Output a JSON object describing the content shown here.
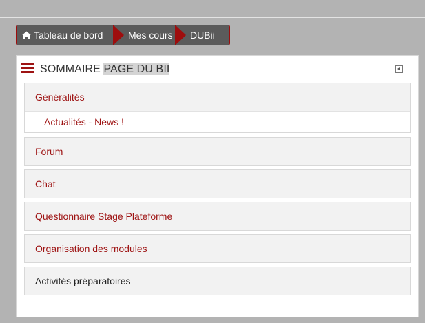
{
  "breadcrumb": {
    "items": [
      {
        "label": "Tableau de bord",
        "icon": "home-icon"
      },
      {
        "label": "Mes cours"
      },
      {
        "label": "DUBii"
      }
    ],
    "background": "#5b5b5b",
    "accent": "#9e0d0d"
  },
  "block": {
    "title_plain": "SOMMAIRE ",
    "title_highlight": "PAGE DU BII",
    "menu_icon": "hamburger-menu-icon",
    "dock_icon": "dock-block-icon"
  },
  "sections": [
    {
      "label": "Généralités",
      "items": [
        "Actualités - News !"
      ]
    },
    {
      "label": "Forum"
    },
    {
      "label": "Chat"
    },
    {
      "label": "Questionnaire Stage Plateforme"
    },
    {
      "label": "Organisation des modules"
    },
    {
      "label": "Activités préparatoires"
    }
  ],
  "colors": {
    "link": "#9e1313",
    "page_background": "#b3b3b3"
  }
}
